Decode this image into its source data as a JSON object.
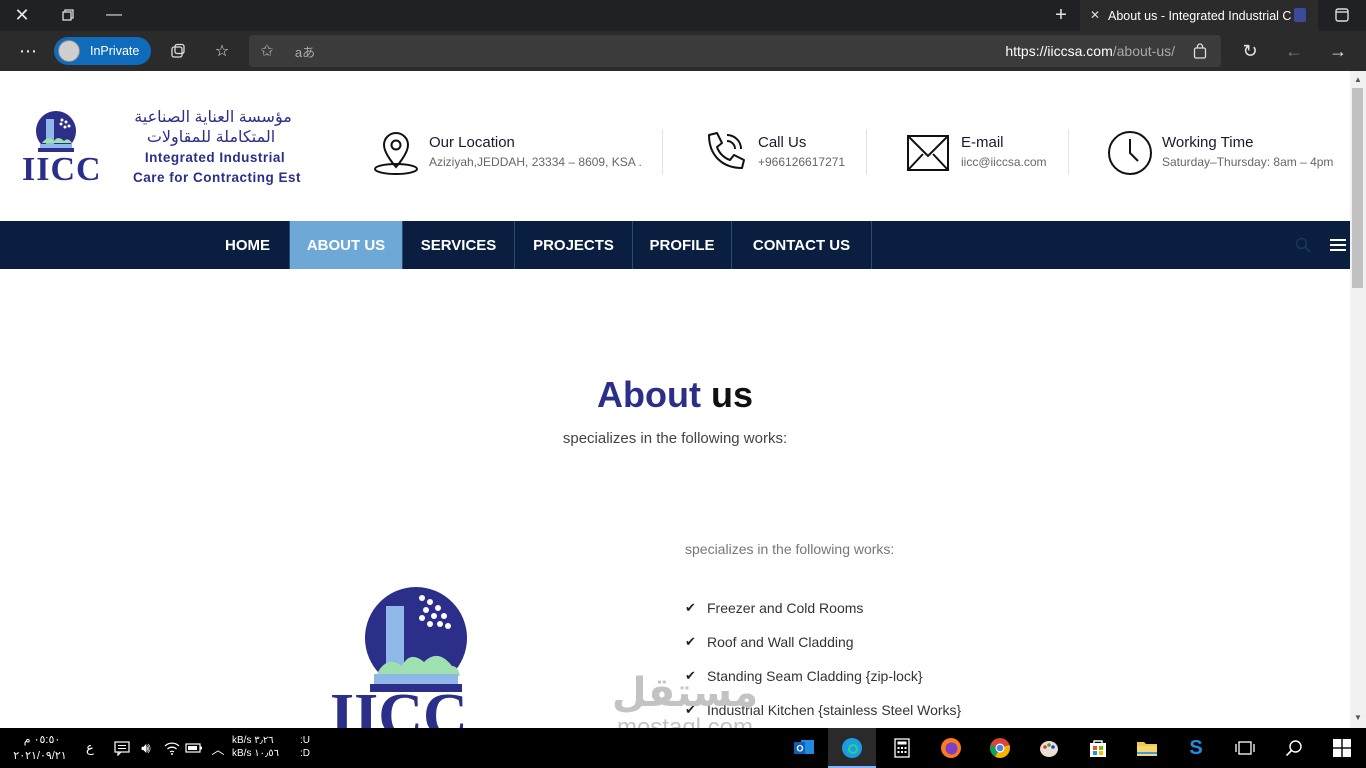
{
  "browser": {
    "tab_title": "About us - Integrated Industrial C",
    "inprivate_label": "InPrivate",
    "url_host": "https://iiccsa.com",
    "url_path": "/about-us/"
  },
  "logo": {
    "arabic_line1": "مؤسسة العناية الصناعية",
    "arabic_line2": "المتكاملة للمقاولات",
    "english_line1": "Integrated Industrial",
    "english_line2": "Care for Contracting Est",
    "brand": "IICC"
  },
  "header": {
    "location": {
      "title": "Our Location",
      "value": "Aziziyah,JEDDAH, 23334 – 8609, KSA ."
    },
    "call": {
      "title": "Call Us",
      "value": "+966126617271"
    },
    "email": {
      "title": "E-mail",
      "value": "iicc@iiccsa.com"
    },
    "hours": {
      "title": "Working Time",
      "value": "Saturday–Thursday: 8am – 4pm"
    }
  },
  "nav": {
    "items": [
      "HOME",
      "ABOUT US",
      "SERVICES",
      "PROJECTS",
      "PROFILE",
      "CONTACT US"
    ],
    "active": "ABOUT US"
  },
  "about": {
    "title_a": "About",
    "title_b": "us",
    "subtitle": "specializes in the following works:",
    "works_heading": "specializes in the following works:",
    "works": [
      "Freezer and Cold Rooms",
      "Roof and Wall Cladding",
      "Standing Seam Cladding {zip-lock}",
      "Industrial Kitchen {stainless Steel Works}"
    ]
  },
  "watermark": {
    "arabic": "مستقل",
    "latin": "mostaql.com"
  },
  "taskbar": {
    "time": "٠٥:٥٠ م",
    "date": "٢٠٢١/٠٩/٢١",
    "lang": "ع",
    "net_up": "kB/s ٣٫٢٦",
    "net_down": "kB/s ١٠٫٥٦",
    "drive_u": ":U",
    "drive_d": ":D"
  },
  "colors": {
    "navy": "#0a1f3f",
    "nav_active": "#6ea8d6",
    "brand_blue": "#2b2f8a",
    "inprivate": "#0f6cbd"
  }
}
